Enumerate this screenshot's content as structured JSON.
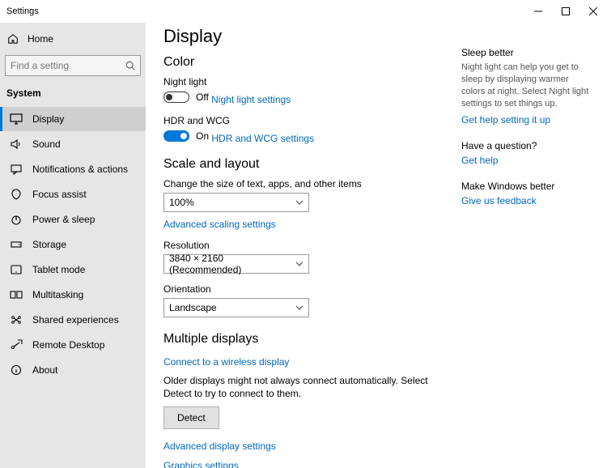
{
  "window": {
    "title": "Settings"
  },
  "sidebar": {
    "home_label": "Home",
    "search_placeholder": "Find a setting",
    "category": "System",
    "items": [
      {
        "label": "Display"
      },
      {
        "label": "Sound"
      },
      {
        "label": "Notifications & actions"
      },
      {
        "label": "Focus assist"
      },
      {
        "label": "Power & sleep"
      },
      {
        "label": "Storage"
      },
      {
        "label": "Tablet mode"
      },
      {
        "label": "Multitasking"
      },
      {
        "label": "Shared experiences"
      },
      {
        "label": "Remote Desktop"
      },
      {
        "label": "About"
      }
    ]
  },
  "page": {
    "title": "Display",
    "sections": {
      "color": {
        "heading": "Color",
        "night_light_label": "Night light",
        "night_light_state": "Off",
        "night_light_link": "Night light settings",
        "hdr_label": "HDR and WCG",
        "hdr_state": "On",
        "hdr_link": "HDR and WCG settings"
      },
      "scale": {
        "heading": "Scale and layout",
        "scale_label": "Change the size of text, apps, and other items",
        "scale_value": "100%",
        "scale_link": "Advanced scaling settings",
        "resolution_label": "Resolution",
        "resolution_value": "3840 × 2160 (Recommended)",
        "orientation_label": "Orientation",
        "orientation_value": "Landscape"
      },
      "multi": {
        "heading": "Multiple displays",
        "connect_link": "Connect to a wireless display",
        "note": "Older displays might not always connect automatically. Select Detect to try to connect to them.",
        "detect_button": "Detect",
        "advanced_link": "Advanced display settings",
        "graphics_link": "Graphics settings"
      }
    }
  },
  "side": {
    "sleep": {
      "title": "Sleep better",
      "body": "Night light can help you get to sleep by displaying warmer colors at night. Select Night light settings to set things up.",
      "link": "Get help setting it up"
    },
    "question": {
      "title": "Have a question?",
      "link": "Get help"
    },
    "better": {
      "title": "Make Windows better",
      "link": "Give us feedback"
    }
  }
}
